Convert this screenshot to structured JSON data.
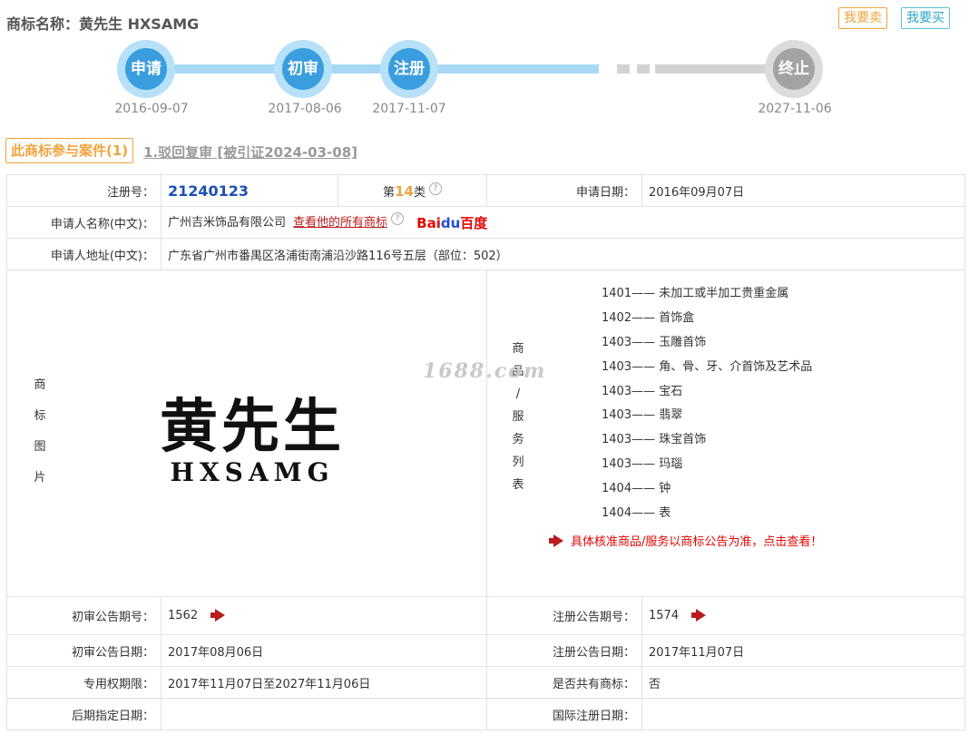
{
  "header": {
    "title": "商标名称：黄先生 HXSAMG",
    "sell_button": "我要卖",
    "buy_button": "我要买"
  },
  "timeline": [
    {
      "label": "申请",
      "date": "2016-09-07"
    },
    {
      "label": "初审",
      "date": "2017-08-06"
    },
    {
      "label": "注册",
      "date": "2017-11-07"
    },
    {
      "label": "终止",
      "date": "2027-11-06"
    }
  ],
  "cases": {
    "tab_label": "此商标参与案件(1)",
    "items": [
      "1.驳回复审 [被引证2024-03-08]"
    ]
  },
  "info": {
    "reg_no_label": "注册号：",
    "reg_no": "21240123",
    "class_prefix": "第",
    "class_num": "14",
    "class_suffix": "类",
    "apply_date_label": "申请日期：",
    "apply_date": "2016年09月07日",
    "applicant_label": "申请人名称(中文)：",
    "applicant": "广州吉米饰品有限公司",
    "all_marks_link": "查看他的所有商标",
    "address_label": "申请人地址(中文)：",
    "address": "广东省广州市番禺区洛浦街南浦沿沙路116号五层（部位：502）",
    "image_label_chars": [
      "商",
      "标",
      "图",
      "片"
    ],
    "mark_cn": "黄先生",
    "mark_en": "HXSAMG",
    "goods_label_chars": [
      "商",
      "品",
      "/",
      "服",
      "务",
      "列",
      "表"
    ],
    "goods": [
      "1401—— 未加工或半加工贵重金属",
      "1402—— 首饰盒",
      "1403—— 玉雕首饰",
      "1403—— 角、骨、牙、介首饰及艺术品",
      "1403—— 宝石",
      "1403—— 翡翠",
      "1403—— 珠宝首饰",
      "1403—— 玛瑙",
      "1404—— 钟",
      "1404—— 表"
    ],
    "goods_note": "具体核准商品/服务以商标公告为准，点击查看！",
    "prelim_no_label": "初审公告期号：",
    "prelim_no": "1562",
    "reg_pub_no_label": "注册公告期号：",
    "reg_pub_no": "1574",
    "prelim_date_label": "初审公告日期：",
    "prelim_date": "2017年08月06日",
    "reg_pub_date_label": "注册公告日期：",
    "reg_pub_date": "2017年11月07日",
    "exclusive_label": "专用权期限：",
    "exclusive": "2017年11月07日至2027年11月06日",
    "shared_label": "是否共有商标：",
    "shared": "否",
    "later_label": "后期指定日期：",
    "intl_label": "国际注册日期："
  },
  "baidu": {
    "part1": "Bai",
    "part2": "du",
    "part3": "百度"
  },
  "watermark": "1688.com"
}
